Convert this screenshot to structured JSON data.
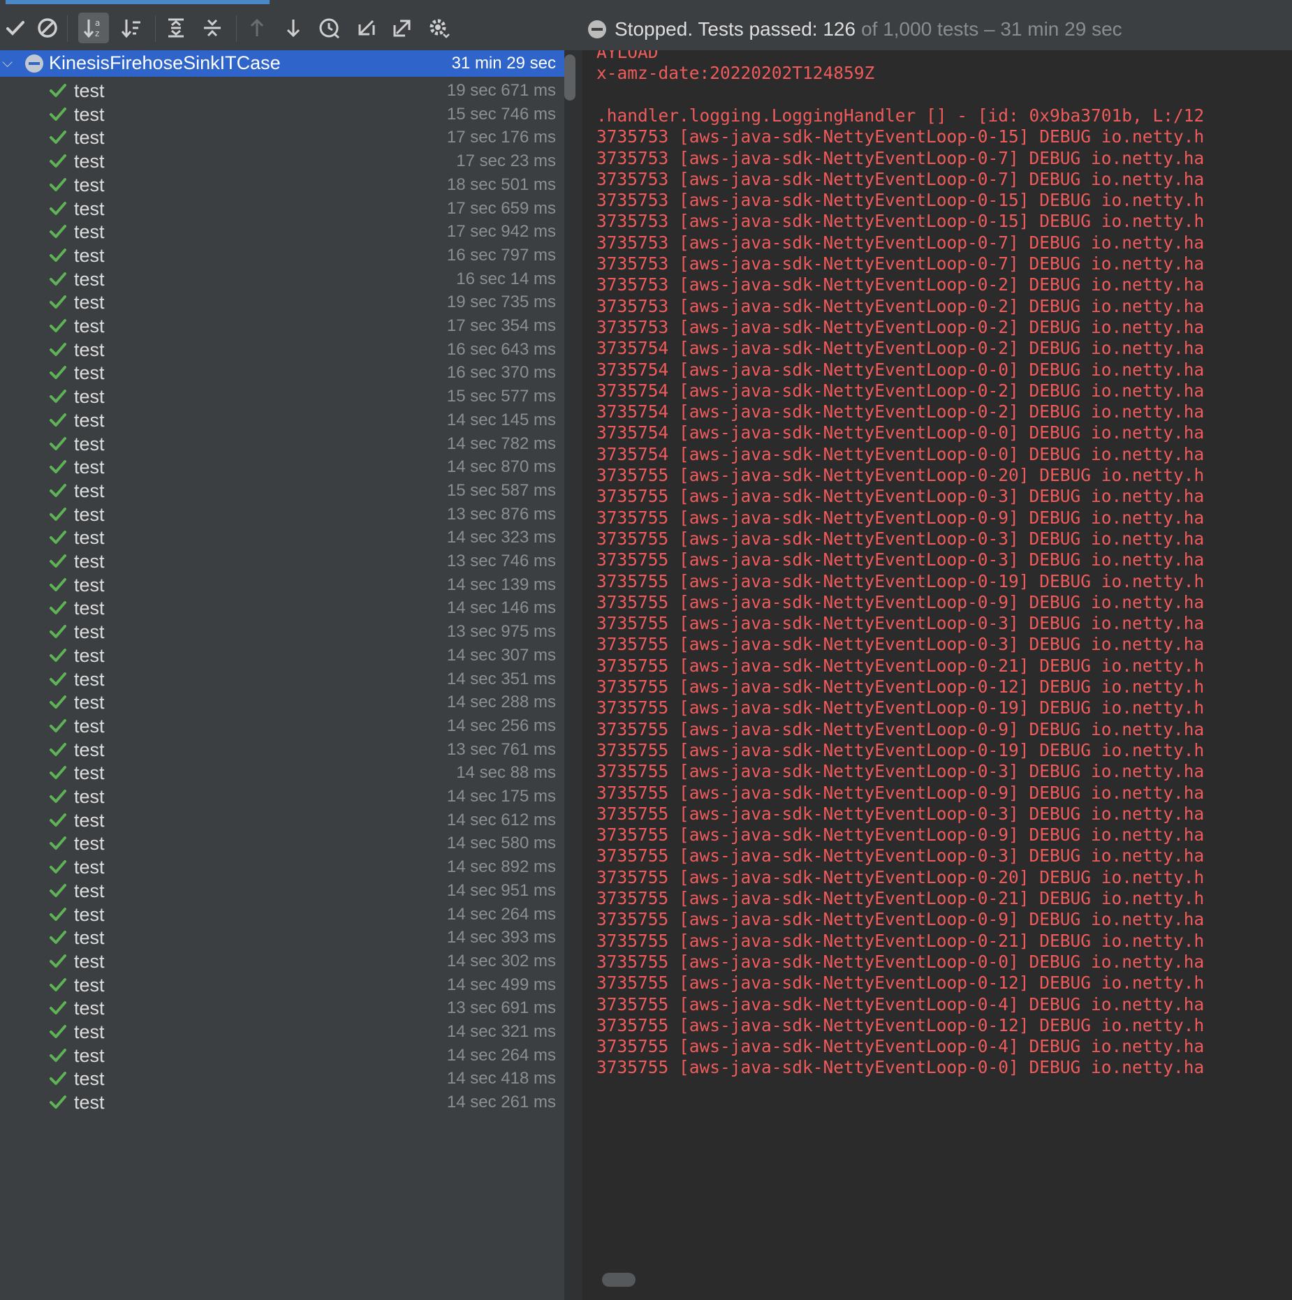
{
  "progress": {
    "fraction": 0.126
  },
  "toolbar": {
    "buttons": [
      {
        "name": "show-passed-icon",
        "active": false
      },
      {
        "name": "show-ignored-icon",
        "active": false
      },
      {
        "name": "sort-alphabetically-icon",
        "active": true
      },
      {
        "name": "sort-by-duration-icon",
        "active": false
      },
      {
        "name": "expand-all-icon",
        "active": false
      },
      {
        "name": "collapse-all-icon",
        "active": false
      },
      {
        "name": "previous-failed-test-icon",
        "active": false
      },
      {
        "name": "next-failed-test-icon",
        "active": false
      },
      {
        "name": "test-history-icon",
        "active": false
      },
      {
        "name": "import-tests-icon",
        "active": false
      },
      {
        "name": "export-results-icon",
        "active": false
      },
      {
        "name": "settings-icon",
        "active": false
      }
    ]
  },
  "status": {
    "prefix": "Stopped. Tests passed: 126",
    "suffix": "of 1,000 tests – 31 min 29 sec"
  },
  "tree": {
    "root": {
      "name": "KinesisFirehoseSinkITCase",
      "time": "31 min 29 sec"
    },
    "tests": [
      {
        "name": "test",
        "time": "19 sec 671 ms"
      },
      {
        "name": "test",
        "time": "15 sec 746 ms"
      },
      {
        "name": "test",
        "time": "17 sec 176 ms"
      },
      {
        "name": "test",
        "time": "17 sec 23 ms"
      },
      {
        "name": "test",
        "time": "18 sec 501 ms"
      },
      {
        "name": "test",
        "time": "17 sec 659 ms"
      },
      {
        "name": "test",
        "time": "17 sec 942 ms"
      },
      {
        "name": "test",
        "time": "16 sec 797 ms"
      },
      {
        "name": "test",
        "time": "16 sec 14 ms"
      },
      {
        "name": "test",
        "time": "19 sec 735 ms"
      },
      {
        "name": "test",
        "time": "17 sec 354 ms"
      },
      {
        "name": "test",
        "time": "16 sec 643 ms"
      },
      {
        "name": "test",
        "time": "16 sec 370 ms"
      },
      {
        "name": "test",
        "time": "15 sec 577 ms"
      },
      {
        "name": "test",
        "time": "14 sec 145 ms"
      },
      {
        "name": "test",
        "time": "14 sec 782 ms"
      },
      {
        "name": "test",
        "time": "14 sec 870 ms"
      },
      {
        "name": "test",
        "time": "15 sec 587 ms"
      },
      {
        "name": "test",
        "time": "13 sec 876 ms"
      },
      {
        "name": "test",
        "time": "14 sec 323 ms"
      },
      {
        "name": "test",
        "time": "13 sec 746 ms"
      },
      {
        "name": "test",
        "time": "14 sec 139 ms"
      },
      {
        "name": "test",
        "time": "14 sec 146 ms"
      },
      {
        "name": "test",
        "time": "13 sec 975 ms"
      },
      {
        "name": "test",
        "time": "14 sec 307 ms"
      },
      {
        "name": "test",
        "time": "14 sec 351 ms"
      },
      {
        "name": "test",
        "time": "14 sec 288 ms"
      },
      {
        "name": "test",
        "time": "14 sec 256 ms"
      },
      {
        "name": "test",
        "time": "13 sec 761 ms"
      },
      {
        "name": "test",
        "time": "14 sec 88 ms"
      },
      {
        "name": "test",
        "time": "14 sec 175 ms"
      },
      {
        "name": "test",
        "time": "14 sec 612 ms"
      },
      {
        "name": "test",
        "time": "14 sec 580 ms"
      },
      {
        "name": "test",
        "time": "14 sec 892 ms"
      },
      {
        "name": "test",
        "time": "14 sec 951 ms"
      },
      {
        "name": "test",
        "time": "14 sec 264 ms"
      },
      {
        "name": "test",
        "time": "14 sec 393 ms"
      },
      {
        "name": "test",
        "time": "14 sec 302 ms"
      },
      {
        "name": "test",
        "time": "14 sec 499 ms"
      },
      {
        "name": "test",
        "time": "13 sec 691 ms"
      },
      {
        "name": "test",
        "time": "14 sec 321 ms"
      },
      {
        "name": "test",
        "time": "14 sec 264 ms"
      },
      {
        "name": "test",
        "time": "14 sec 418 ms"
      },
      {
        "name": "test",
        "time": "14 sec 261 ms"
      }
    ]
  },
  "console": {
    "lines": [
      "AYLOAD",
      "x-amz-date:20220202T124859Z",
      "",
      ".handler.logging.LoggingHandler [] - [id: 0x9ba3701b, L:/12",
      "3735753 [aws-java-sdk-NettyEventLoop-0-15] DEBUG io.netty.h",
      "3735753 [aws-java-sdk-NettyEventLoop-0-7] DEBUG io.netty.ha",
      "3735753 [aws-java-sdk-NettyEventLoop-0-7] DEBUG io.netty.ha",
      "3735753 [aws-java-sdk-NettyEventLoop-0-15] DEBUG io.netty.h",
      "3735753 [aws-java-sdk-NettyEventLoop-0-15] DEBUG io.netty.h",
      "3735753 [aws-java-sdk-NettyEventLoop-0-7] DEBUG io.netty.ha",
      "3735753 [aws-java-sdk-NettyEventLoop-0-7] DEBUG io.netty.ha",
      "3735753 [aws-java-sdk-NettyEventLoop-0-2] DEBUG io.netty.ha",
      "3735753 [aws-java-sdk-NettyEventLoop-0-2] DEBUG io.netty.ha",
      "3735753 [aws-java-sdk-NettyEventLoop-0-2] DEBUG io.netty.ha",
      "3735754 [aws-java-sdk-NettyEventLoop-0-2] DEBUG io.netty.ha",
      "3735754 [aws-java-sdk-NettyEventLoop-0-0] DEBUG io.netty.ha",
      "3735754 [aws-java-sdk-NettyEventLoop-0-2] DEBUG io.netty.ha",
      "3735754 [aws-java-sdk-NettyEventLoop-0-2] DEBUG io.netty.ha",
      "3735754 [aws-java-sdk-NettyEventLoop-0-0] DEBUG io.netty.ha",
      "3735754 [aws-java-sdk-NettyEventLoop-0-0] DEBUG io.netty.ha",
      "3735755 [aws-java-sdk-NettyEventLoop-0-20] DEBUG io.netty.h",
      "3735755 [aws-java-sdk-NettyEventLoop-0-3] DEBUG io.netty.ha",
      "3735755 [aws-java-sdk-NettyEventLoop-0-9] DEBUG io.netty.ha",
      "3735755 [aws-java-sdk-NettyEventLoop-0-3] DEBUG io.netty.ha",
      "3735755 [aws-java-sdk-NettyEventLoop-0-3] DEBUG io.netty.ha",
      "3735755 [aws-java-sdk-NettyEventLoop-0-19] DEBUG io.netty.h",
      "3735755 [aws-java-sdk-NettyEventLoop-0-9] DEBUG io.netty.ha",
      "3735755 [aws-java-sdk-NettyEventLoop-0-3] DEBUG io.netty.ha",
      "3735755 [aws-java-sdk-NettyEventLoop-0-3] DEBUG io.netty.ha",
      "3735755 [aws-java-sdk-NettyEventLoop-0-21] DEBUG io.netty.h",
      "3735755 [aws-java-sdk-NettyEventLoop-0-12] DEBUG io.netty.h",
      "3735755 [aws-java-sdk-NettyEventLoop-0-19] DEBUG io.netty.h",
      "3735755 [aws-java-sdk-NettyEventLoop-0-9] DEBUG io.netty.ha",
      "3735755 [aws-java-sdk-NettyEventLoop-0-19] DEBUG io.netty.h",
      "3735755 [aws-java-sdk-NettyEventLoop-0-3] DEBUG io.netty.ha",
      "3735755 [aws-java-sdk-NettyEventLoop-0-9] DEBUG io.netty.ha",
      "3735755 [aws-java-sdk-NettyEventLoop-0-3] DEBUG io.netty.ha",
      "3735755 [aws-java-sdk-NettyEventLoop-0-9] DEBUG io.netty.ha",
      "3735755 [aws-java-sdk-NettyEventLoop-0-3] DEBUG io.netty.ha",
      "3735755 [aws-java-sdk-NettyEventLoop-0-20] DEBUG io.netty.h",
      "3735755 [aws-java-sdk-NettyEventLoop-0-21] DEBUG io.netty.h",
      "3735755 [aws-java-sdk-NettyEventLoop-0-9] DEBUG io.netty.ha",
      "3735755 [aws-java-sdk-NettyEventLoop-0-21] DEBUG io.netty.h",
      "3735755 [aws-java-sdk-NettyEventLoop-0-0] DEBUG io.netty.ha",
      "3735755 [aws-java-sdk-NettyEventLoop-0-12] DEBUG io.netty.h",
      "3735755 [aws-java-sdk-NettyEventLoop-0-4] DEBUG io.netty.ha",
      "3735755 [aws-java-sdk-NettyEventLoop-0-12] DEBUG io.netty.h",
      "3735755 [aws-java-sdk-NettyEventLoop-0-4] DEBUG io.netty.ha",
      "3735755 [aws-java-sdk-NettyEventLoop-0-0] DEBUG io.netty.ha"
    ]
  }
}
